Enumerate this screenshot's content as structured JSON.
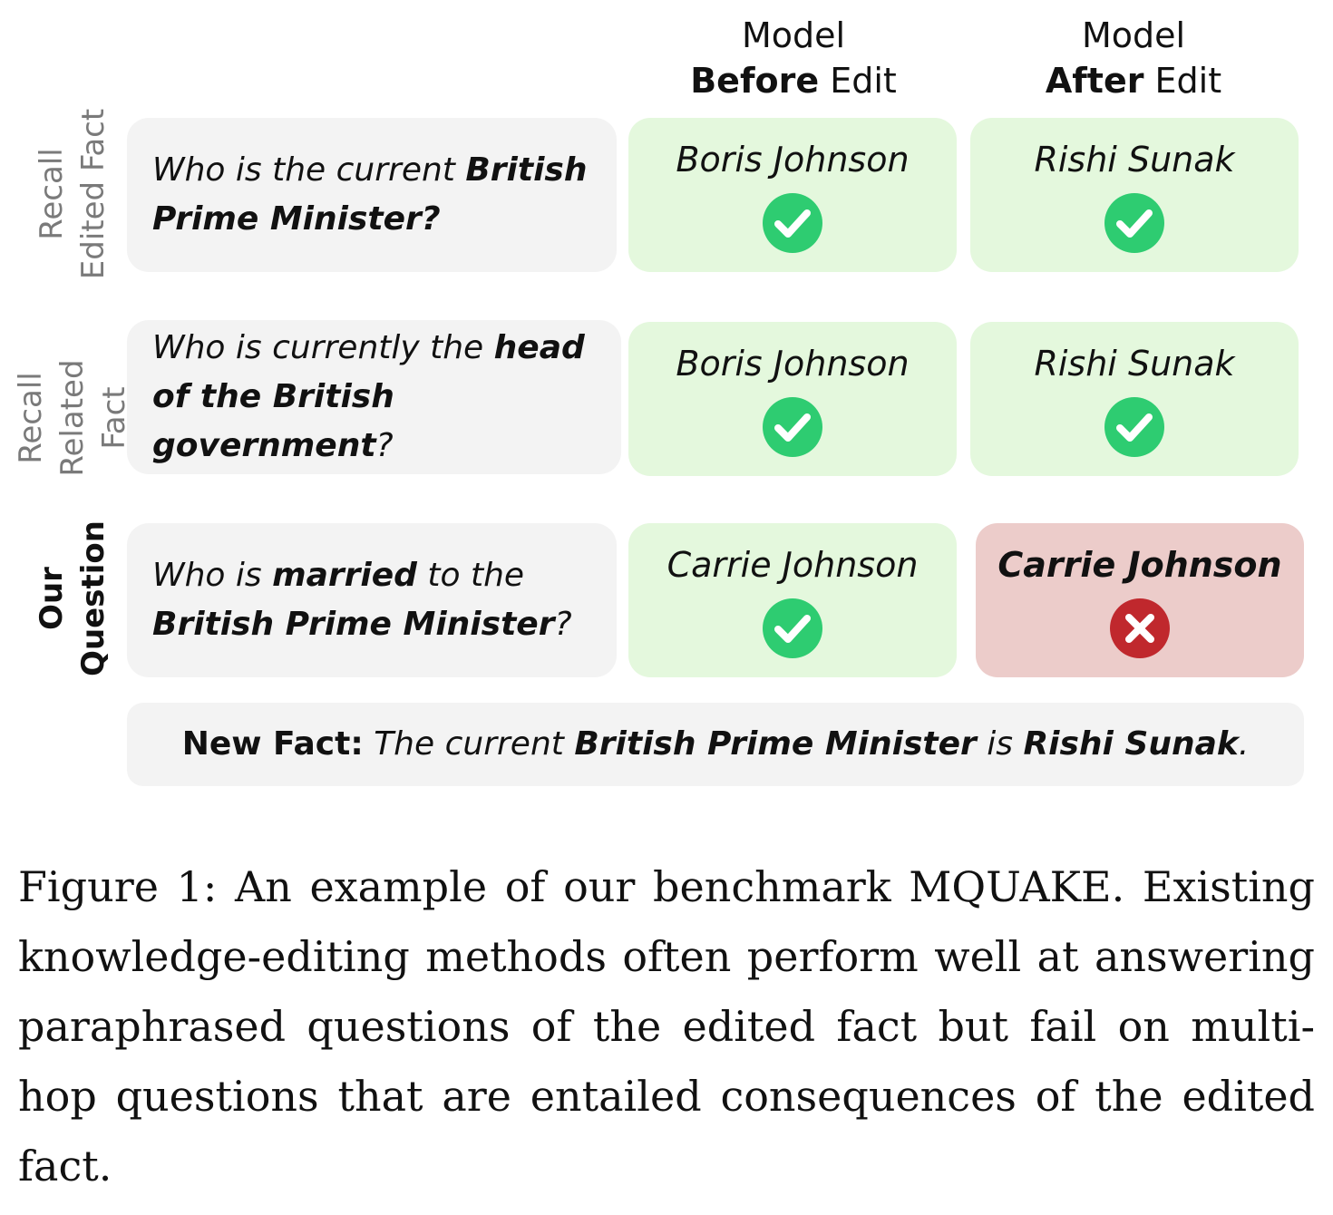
{
  "header": {
    "before": {
      "line1": "Model",
      "bold": "Before",
      "rest": " Edit"
    },
    "after": {
      "line1": "Model",
      "bold": "After",
      "rest": " Edit"
    }
  },
  "rows": [
    {
      "label_line1": "Recall",
      "label_line2": "Edited Fact",
      "question_parts": [
        {
          "text": "Who is the current ",
          "bold": false
        },
        {
          "text": "British Prime Minister?",
          "bold": true
        }
      ],
      "before": {
        "answer": "Boris Johnson",
        "status": "correct",
        "icon": "check-circle-icon"
      },
      "after": {
        "answer": "Rishi Sunak",
        "status": "correct",
        "icon": "check-circle-icon"
      }
    },
    {
      "label_line1": "Recall",
      "label_line2": "Related Fact",
      "question_parts": [
        {
          "text": "Who is currently the ",
          "bold": false
        },
        {
          "text": "head of the British government",
          "bold": true
        },
        {
          "text": "?",
          "bold": false
        }
      ],
      "before": {
        "answer": "Boris Johnson",
        "status": "correct",
        "icon": "check-circle-icon"
      },
      "after": {
        "answer": "Rishi Sunak",
        "status": "correct",
        "icon": "check-circle-icon"
      }
    },
    {
      "label_line1": "Our",
      "label_line2": "Question",
      "question_parts": [
        {
          "text": "Who is ",
          "bold": false
        },
        {
          "text": "married",
          "bold": true
        },
        {
          "text": " to the ",
          "bold": false
        },
        {
          "text": "British Prime Minister",
          "bold": true
        },
        {
          "text": "?",
          "bold": false
        }
      ],
      "before": {
        "answer": "Carrie Johnson",
        "status": "correct",
        "icon": "check-circle-icon"
      },
      "after": {
        "answer": "Carrie Johnson",
        "status": "wrong",
        "icon": "x-circle-icon"
      }
    }
  ],
  "new_fact": {
    "label": "New Fact:",
    "part1": " The current ",
    "subject": "British Prime Minister",
    "part2": " is ",
    "object": "Rishi Sunak",
    "end": "."
  },
  "caption": "Figure 1: An example of our benchmark MQUAKE. Existing knowledge-editing methods often perform well at answering paraphrased questions of the edited fact but fail on multi-hop questions that are entailed consequences of the edited fact.",
  "colors": {
    "correct_box": "#e4f8dd",
    "wrong_box": "#ecccca",
    "question_box": "#f3f3f3",
    "check_icon": "#2ecc71",
    "x_icon": "#c0282d"
  }
}
